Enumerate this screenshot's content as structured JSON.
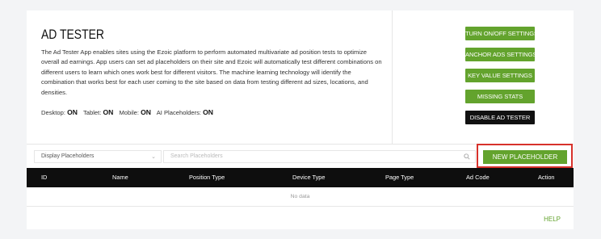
{
  "header": {
    "title": "AD TESTER",
    "description": "The Ad Tester App enables sites using the Ezoic platform to perform automated multivariate ad position tests to optimize overall ad earnings. App users can set ad placeholders on their site and Ezoic will automatically test different combinations on different users to learn which ones work best for different visitors. The machine learning technology will identify the combination that works best for each user coming to the site based on data from testing different ad sizes, locations, and densities."
  },
  "devices": {
    "desktop_label": "Desktop:",
    "desktop_value": "ON",
    "tablet_label": "Tablet:",
    "tablet_value": "ON",
    "mobile_label": "Mobile:",
    "mobile_value": "ON",
    "ai_label": "AI Placeholders:",
    "ai_value": "ON"
  },
  "actions": {
    "turn_onoff": "TURN ON/OFF SETTINGS",
    "anchor_ads": "ANCHOR ADS SETTINGS",
    "key_value": "KEY VALUE SETTINGS",
    "missing_stats": "MISSING STATS",
    "disable": "DISABLE AD TESTER"
  },
  "filters": {
    "selected": "Display Placeholders",
    "search_placeholder": "Search Placeholders",
    "new_placeholder": "NEW PLACEHOLDER"
  },
  "table": {
    "columns": [
      "ID",
      "Name",
      "Position Type",
      "Device Type",
      "Page Type",
      "Ad Code",
      "Action"
    ],
    "empty_text": "No data"
  },
  "footer": {
    "help": "HELP"
  },
  "colors": {
    "accent_green": "#63a32d",
    "highlight_red": "#d7312b",
    "table_header": "#0e0e0e"
  }
}
